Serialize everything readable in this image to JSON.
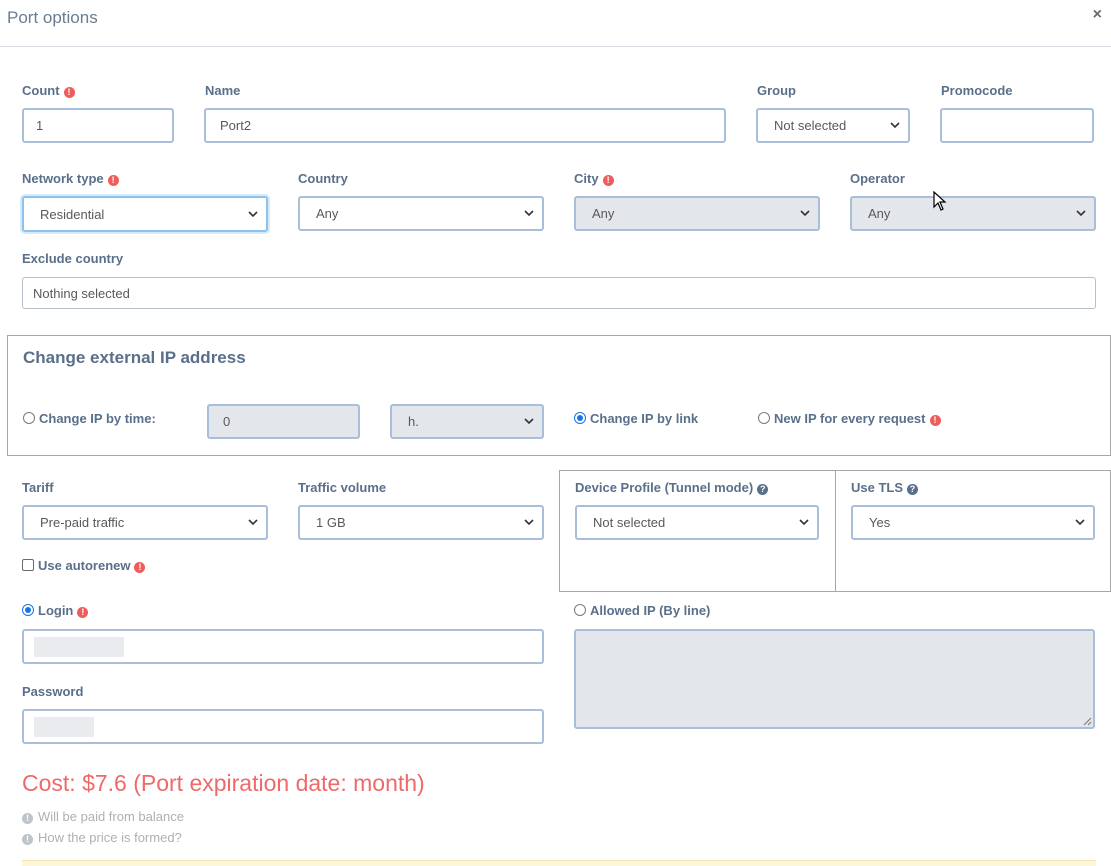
{
  "modal": {
    "title": "Port options",
    "close": "×"
  },
  "count": {
    "label": "Count",
    "value": "1"
  },
  "name": {
    "label": "Name",
    "value": "Port2"
  },
  "group": {
    "label": "Group",
    "value": "Not selected"
  },
  "promocode": {
    "label": "Promocode",
    "value": ""
  },
  "network_type": {
    "label": "Network type",
    "value": "Residential"
  },
  "country": {
    "label": "Country",
    "value": "Any"
  },
  "city": {
    "label": "City",
    "value": "Any"
  },
  "operator": {
    "label": "Operator",
    "value": "Any"
  },
  "exclude_country": {
    "label": "Exclude country",
    "value": "Nothing selected"
  },
  "change_ip": {
    "title": "Change external IP address",
    "by_time_label": "Change IP by time:",
    "time_value": "0",
    "unit_value": "h.",
    "by_link_label": "Change IP by link",
    "every_request_label": "New IP for every request"
  },
  "tariff": {
    "label": "Tariff",
    "value": "Pre-paid traffic"
  },
  "traffic_volume": {
    "label": "Traffic volume",
    "value": "1 GB"
  },
  "device_profile": {
    "label": "Device Profile (Tunnel mode)",
    "value": "Not selected"
  },
  "use_tls": {
    "label": "Use TLS",
    "value": "Yes"
  },
  "autorenew": {
    "label": "Use autorenew"
  },
  "login": {
    "label": "Login"
  },
  "password": {
    "label": "Password"
  },
  "allowed_ip": {
    "label": "Allowed IP (By line)",
    "value": ""
  },
  "cost": {
    "text": "Cost: $7.6 (Port expiration date: month)"
  },
  "notes": {
    "balance": "Will be paid from balance",
    "price": "How the price is formed?"
  },
  "icons": {
    "warning": "exclamation-circle-icon",
    "help": "question-circle-icon",
    "info": "info-circle-icon"
  },
  "colors": {
    "accent": "#1a73e8",
    "warning": "#ee5c5c",
    "cost": "#ee6a6a",
    "label": "#5a6f8a"
  }
}
